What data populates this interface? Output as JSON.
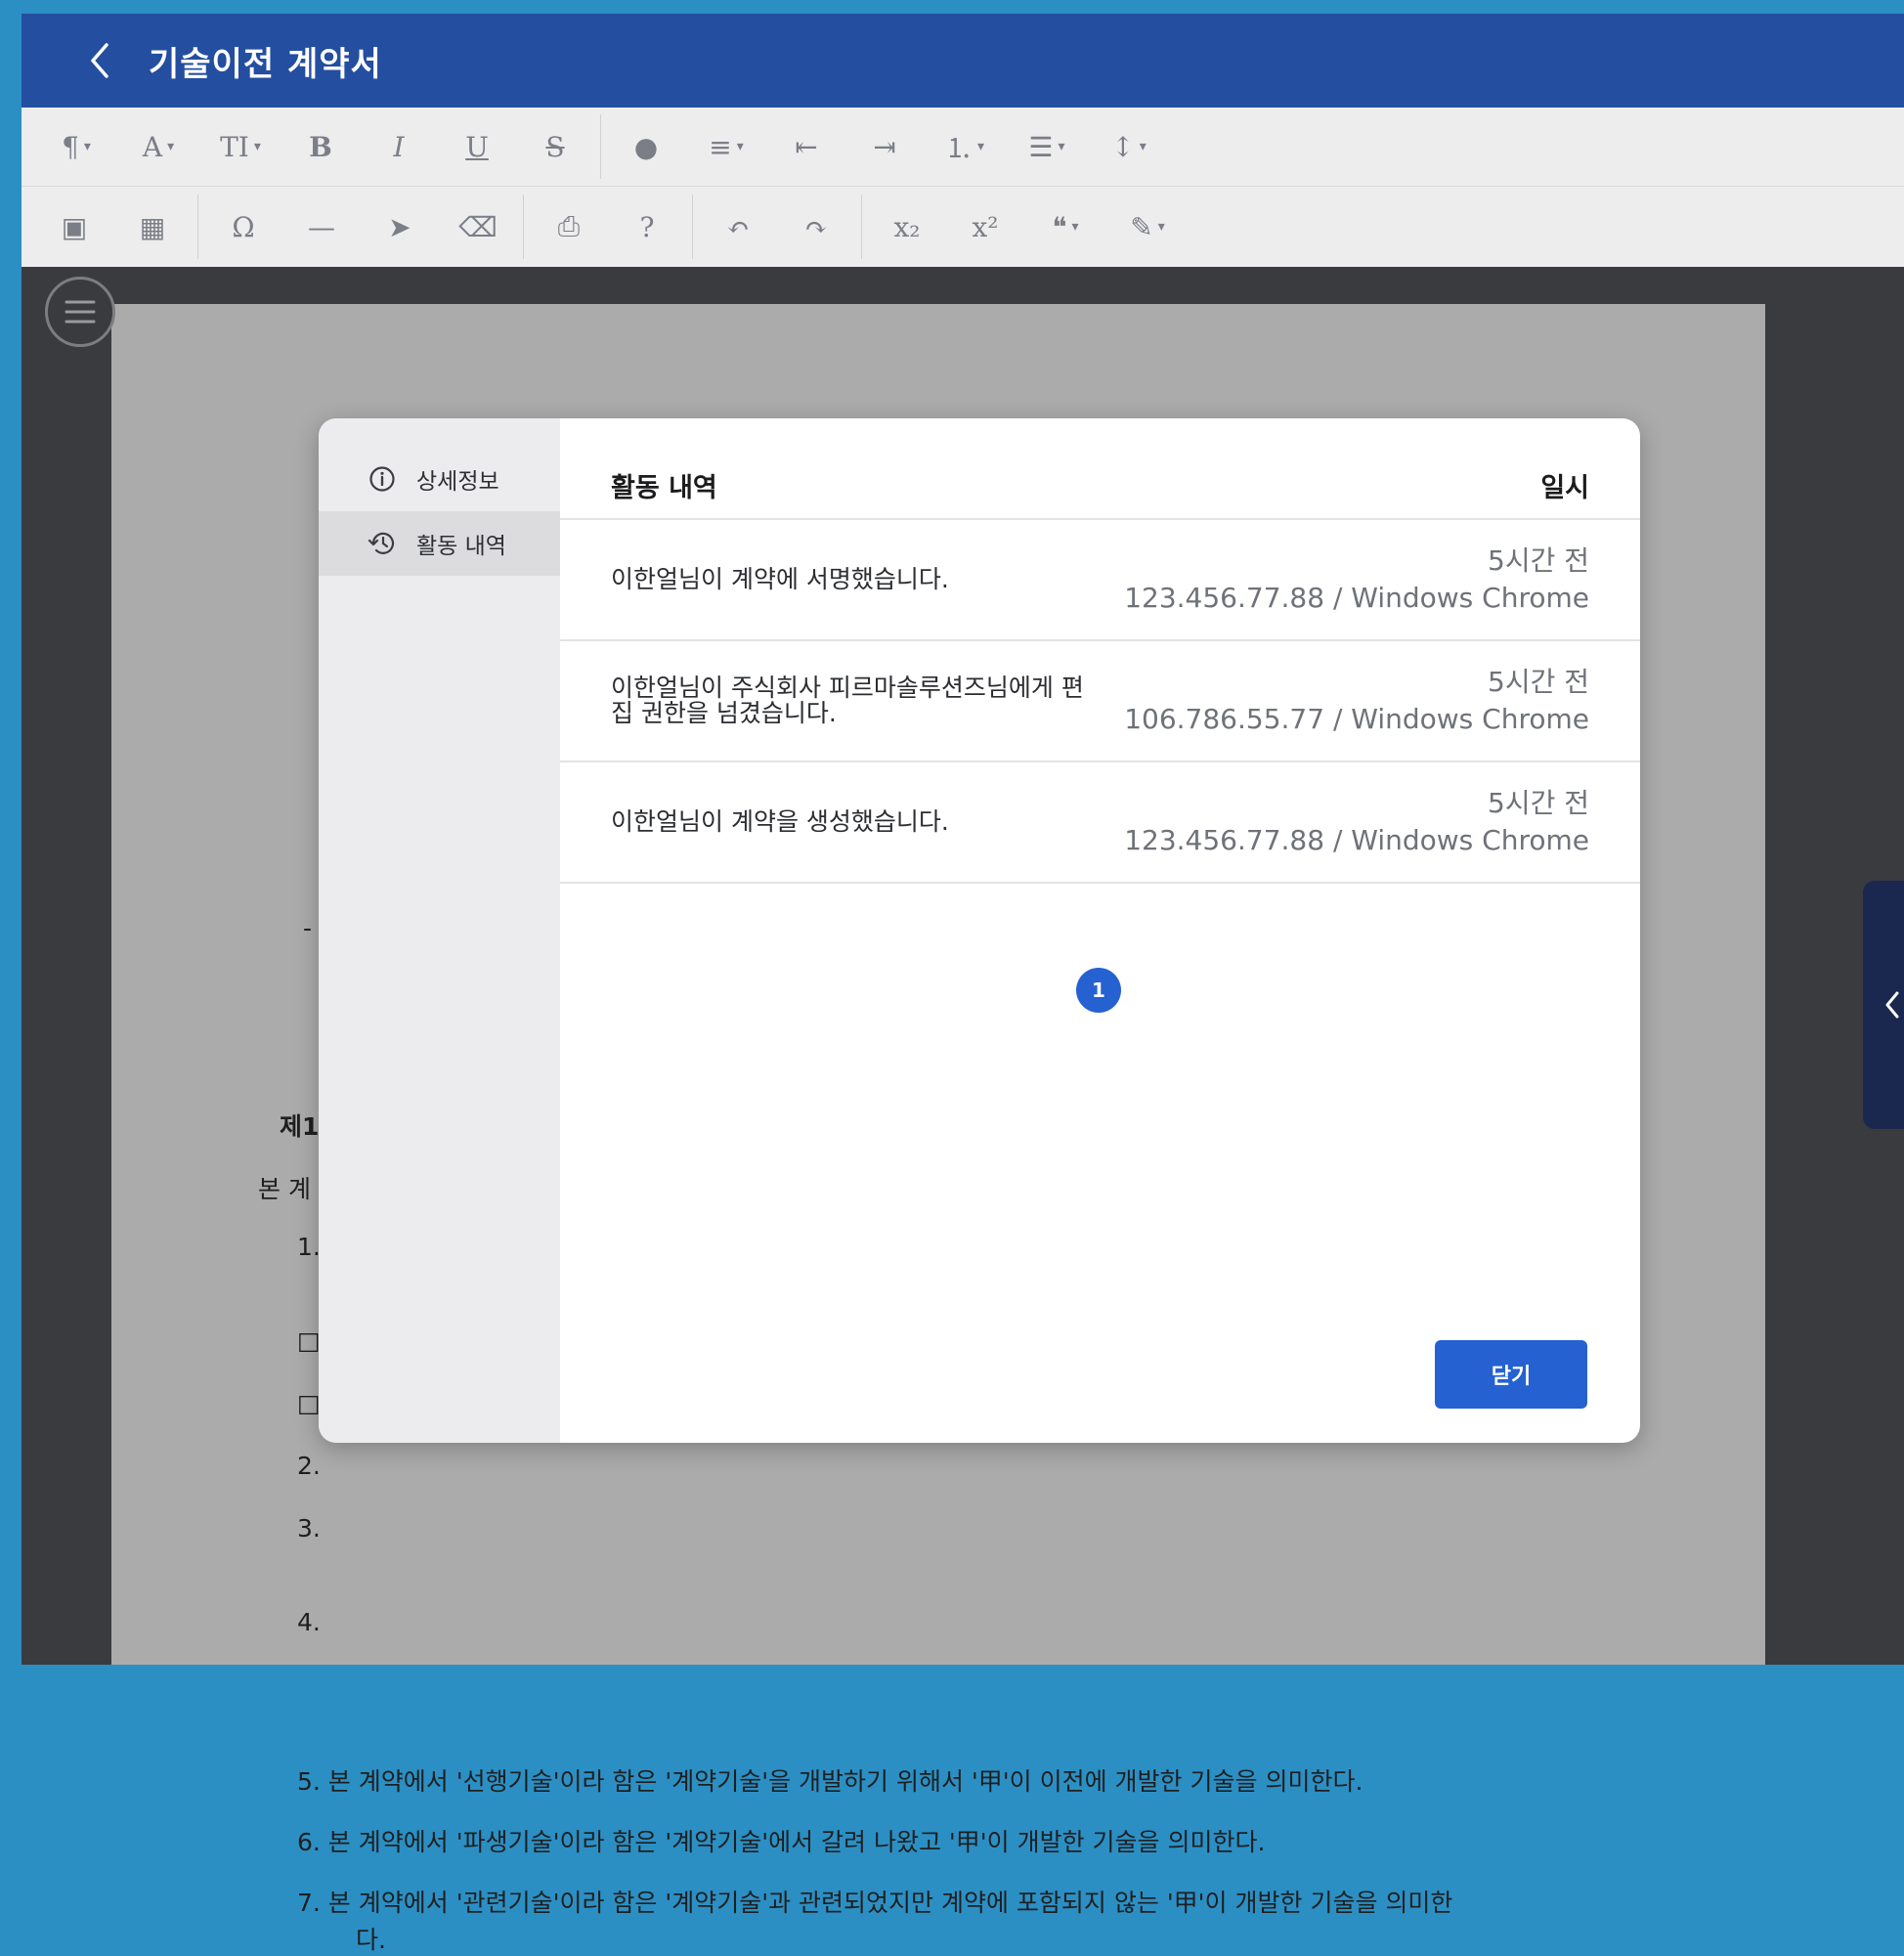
{
  "header": {
    "title": "기술이전 계약서",
    "back_icon": "chevron-left-icon"
  },
  "toolbar": {
    "row1": [
      {
        "name": "paragraph-style",
        "glyph": "¶",
        "caret": true
      },
      {
        "name": "font-family",
        "glyph": "A",
        "caret": true
      },
      {
        "name": "font-size",
        "glyph": "TI",
        "caret": true
      },
      {
        "name": "bold",
        "glyph": "B"
      },
      {
        "name": "italic",
        "glyph": "I"
      },
      {
        "name": "underline",
        "glyph": "U"
      },
      {
        "name": "strikethrough",
        "glyph": "S"
      },
      {
        "sep": true
      },
      {
        "name": "text-color",
        "glyph": "●"
      },
      {
        "name": "align",
        "glyph": "≡",
        "caret": true
      },
      {
        "name": "outdent",
        "glyph": "⇤"
      },
      {
        "name": "indent",
        "glyph": "⇥"
      },
      {
        "name": "ordered-list",
        "glyph": "⒈",
        "caret": true
      },
      {
        "name": "unordered-list",
        "glyph": "☰",
        "caret": true
      },
      {
        "name": "line-height",
        "glyph": "↕",
        "caret": true
      }
    ],
    "row2": [
      {
        "name": "image",
        "glyph": "▣"
      },
      {
        "name": "table",
        "glyph": "▦"
      },
      {
        "sep": true
      },
      {
        "name": "special-char",
        "glyph": "Ω"
      },
      {
        "name": "horizontal-rule",
        "glyph": "—"
      },
      {
        "name": "select",
        "glyph": "➤"
      },
      {
        "name": "eraser",
        "glyph": "⌫"
      },
      {
        "sep": true
      },
      {
        "name": "print",
        "glyph": "⎙"
      },
      {
        "name": "help",
        "glyph": "?"
      },
      {
        "sep": true
      },
      {
        "name": "undo",
        "glyph": "↶"
      },
      {
        "name": "redo",
        "glyph": "↷"
      },
      {
        "sep": true
      },
      {
        "name": "subscript",
        "glyph": "x₂"
      },
      {
        "name": "superscript",
        "glyph": "x²"
      },
      {
        "name": "blockquote",
        "glyph": "❝",
        "caret": true
      },
      {
        "name": "magic",
        "glyph": "✎",
        "caret": true
      }
    ]
  },
  "document": {
    "heading_fragment": "제1",
    "lines": [
      {
        "text": "5. 본 계약에서 '선행기술'이라 함은 '계약기술'을 개발하기 위해서 '甲'이 이전에 개발한 기술을 의미한다."
      },
      {
        "text": "6. 본 계약에서 '파생기술'이라 함은 '계약기술'에서 갈려 나왔고 '甲'이 개발한 기술을 의미한다."
      },
      {
        "text": "7. 본 계약에서 '관련기술'이라 함은 '계약기술'과 관련되었지만 계약에 포함되지 않는 '甲'이 개발한 기술을 의미한"
      },
      {
        "text": "다."
      }
    ],
    "left_fragments": [
      "-",
      "제1",
      "본 계",
      "1.",
      "□",
      "□",
      "2.",
      "3.",
      "4."
    ]
  },
  "modal": {
    "nav": [
      {
        "label": "상세정보",
        "icon": "info-icon",
        "active": false
      },
      {
        "label": "활동 내역",
        "icon": "history-icon",
        "active": true
      }
    ],
    "columns": {
      "activity": "활동 내역",
      "datetime": "일시"
    },
    "rows": [
      {
        "message": "이한얼님이 계약에 서명했습니다.",
        "time": "5시간 전",
        "meta": "123.456.77.88 / Windows Chrome"
      },
      {
        "message": "이한얼님이 주식회사 피르마솔루션즈님에게 편집 권한을 넘겼습니다.",
        "time": "5시간 전",
        "meta": "106.786.55.77 / Windows Chrome"
      },
      {
        "message": "이한얼님이 계약을 생성했습니다.",
        "time": "5시간 전",
        "meta": "123.456.77.88 / Windows Chrome"
      }
    ],
    "pagination": {
      "current": "1"
    },
    "close_label": "닫기"
  },
  "colors": {
    "header": "#244ea0",
    "accent": "#2561d1",
    "backdrop": "#3a3b3f"
  }
}
